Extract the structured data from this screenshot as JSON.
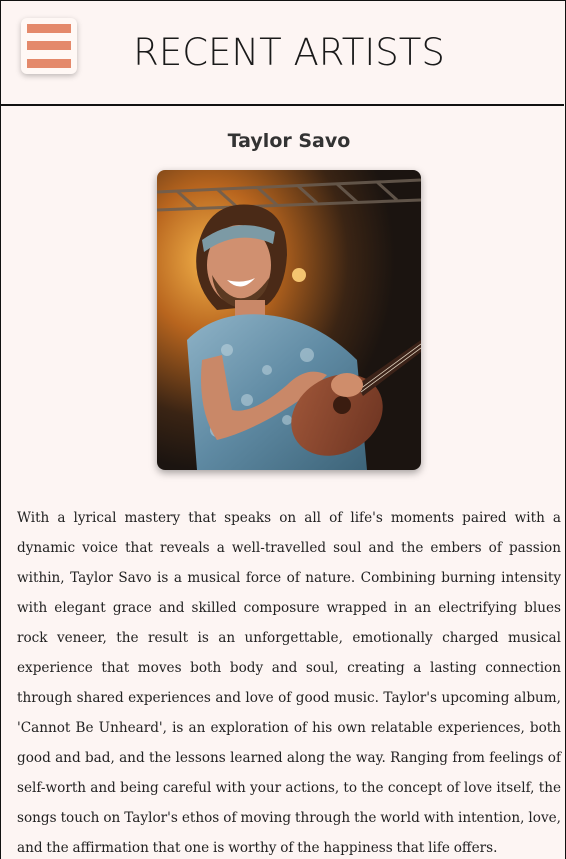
{
  "header": {
    "title": "RECENT ARTISTS",
    "menu_icon": "hamburger-menu-icon"
  },
  "artist": {
    "name": "Taylor Savo",
    "bio": "With a lyrical mastery that speaks on all of life's moments paired with a dynamic voice that reveals a well-travelled soul and the embers of passion within, Taylor Savo is a musical force of nature. Combining burning intensity with elegant grace and skilled composure wrapped in an electrifying blues rock veneer, the result is an unforgettable, emotionally charged musical experience that moves both body and soul, creating a lasting connection through shared experiences and love of good music. Taylor's upcoming album, 'Cannot Be Unheard', is an exploration of his own relatable experiences, both good and bad, and the lessons learned along the way. Ranging from feelings of self-worth and being careful with your actions, to the concept of love itself, the songs touch on Taylor's ethos of moving through the world with intention, love, and the affirmation that one is worthy of the happiness that life offers."
  },
  "colors": {
    "background": "#fdf5f3",
    "accent": "#e4896b",
    "border": "#111111"
  }
}
